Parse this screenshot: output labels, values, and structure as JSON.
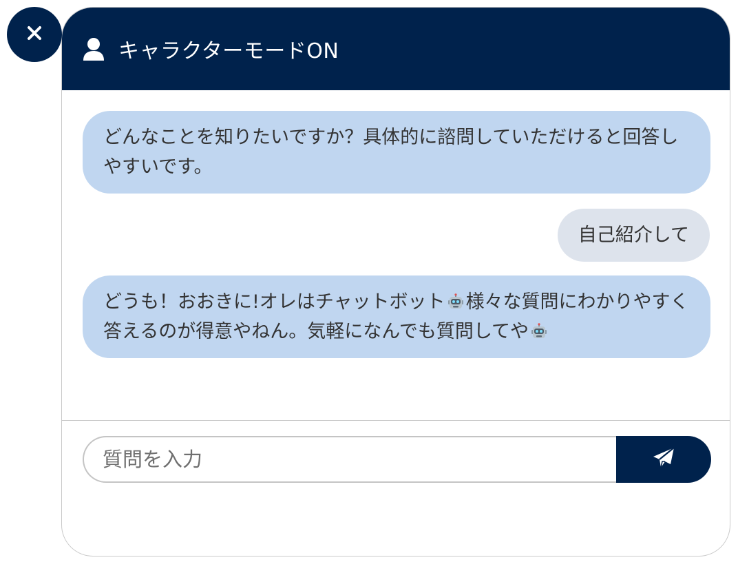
{
  "header": {
    "title": "キャラクターモードON"
  },
  "messages": [
    {
      "role": "bot",
      "text": "どんなことを知りたいですか？具体的に諮問していただけると回答しやすいです。"
    },
    {
      "role": "user",
      "text": "自己紹介して"
    },
    {
      "role": "bot",
      "part1": "どうも！おおきに!オレはチャットボット",
      "part2": "様々な質問にわかりやすく答えるのが得意やねん。気軽になんでも質問してや"
    }
  ],
  "input": {
    "placeholder": "質問を入力",
    "value": ""
  },
  "icons": {
    "close": "close-icon",
    "user": "user-icon",
    "send": "paper-plane-icon",
    "emoji": "robot-face-emoji"
  },
  "colors": {
    "brand": "#00224c",
    "bot_bubble": "#c0d6f0",
    "user_bubble": "#dde3ec"
  }
}
